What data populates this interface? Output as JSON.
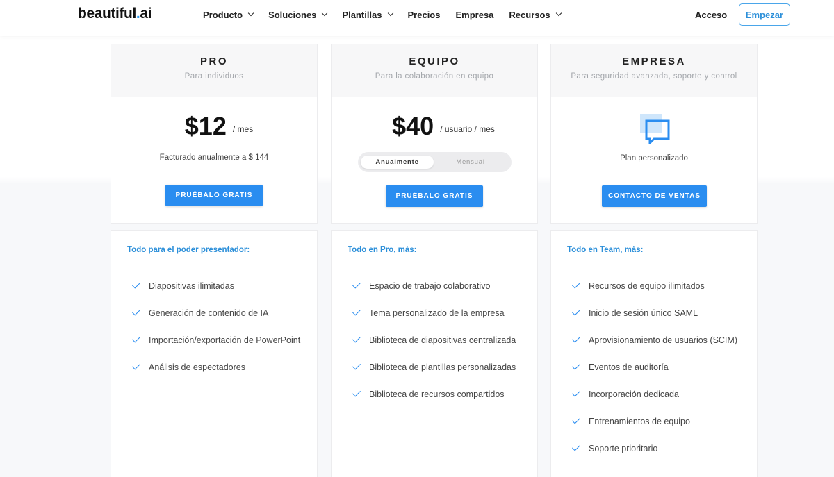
{
  "brand": {
    "name_main": "beautiful",
    "name_dot": ".",
    "name_suffix": "ai",
    "accent": "#2a8df0"
  },
  "nav": {
    "items": [
      {
        "label": "Producto",
        "dropdown": true
      },
      {
        "label": "Soluciones",
        "dropdown": true
      },
      {
        "label": "Plantillas",
        "dropdown": true
      },
      {
        "label": "Precios",
        "dropdown": false
      },
      {
        "label": "Empresa",
        "dropdown": false
      },
      {
        "label": "Recursos",
        "dropdown": true
      }
    ],
    "login": "Acceso",
    "start": "Empezar"
  },
  "plans": {
    "pro": {
      "name": "PRO",
      "subtitle": "Para individuos",
      "price": "$12",
      "unit": "/ mes",
      "billed": "Facturado anualmente a $ 144",
      "cta": "PRUÉBALO GRATIS"
    },
    "team": {
      "name": "EQUIPO",
      "subtitle": "Para la colaboración en equipo",
      "price": "$40",
      "unit": "/ usuario / mes",
      "toggle_on": "Anualmente",
      "toggle_off": "Mensual",
      "cta": "PRUÉBALO GRATIS"
    },
    "enterprise": {
      "name": "EMPRESA",
      "subtitle": "Para seguridad avanzada, soporte y control",
      "icon": "chat-bubble-icon",
      "custom": "Plan personalizado",
      "cta": "CONTACTO DE VENTAS"
    }
  },
  "features": {
    "pro": {
      "title": "Todo para el poder presentador:",
      "items": [
        "Diapositivas ilimitadas",
        "Generación de contenido de IA",
        "Importación/exportación de PowerPoint",
        "Análisis de espectadores"
      ]
    },
    "team": {
      "title": "Todo en Pro, más:",
      "items": [
        "Espacio de trabajo colaborativo",
        "Tema personalizado de la empresa",
        "Biblioteca de diapositivas centralizada",
        "Biblioteca de plantillas personalizadas",
        "Biblioteca de recursos compartidos"
      ]
    },
    "enterprise": {
      "title": "Todo en Team, más:",
      "items": [
        "Recursos de equipo ilimitados",
        "Inicio de sesión único SAML",
        "Aprovisionamiento de usuarios (SCIM)",
        "Eventos de auditoría",
        "Incorporación dedicada",
        "Entrenamientos de equipo",
        "Soporte prioritario"
      ]
    }
  }
}
